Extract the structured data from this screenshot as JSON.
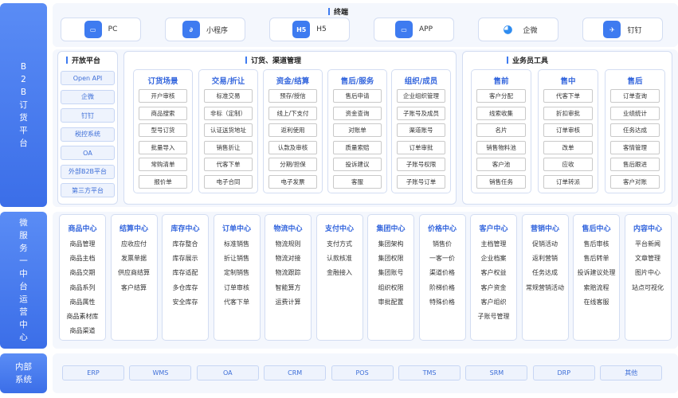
{
  "sides": {
    "b2b": "B2B订货平台",
    "mid": "微服务一中台运营中心",
    "internal": "内部系统"
  },
  "terminal": {
    "title": "终端",
    "items": [
      {
        "label": "PC",
        "icon": "monitor-icon"
      },
      {
        "label": "小程序",
        "icon": "mini-program-icon"
      },
      {
        "label": "H5",
        "icon": "h5-icon"
      },
      {
        "label": "APP",
        "icon": "monitor-icon"
      },
      {
        "label": "企微",
        "icon": "wecom-icon"
      },
      {
        "label": "钉钉",
        "icon": "dingtalk-icon"
      }
    ]
  },
  "open_platform": {
    "title": "开放平台",
    "items": [
      "Open API",
      "企微",
      "钉钉",
      "税控系统",
      "OA",
      "外部B2B平台",
      "第三方平台"
    ]
  },
  "ordering": {
    "title": "订货、渠道管理",
    "cols": [
      {
        "title": "订货场景",
        "items": [
          "开户审核",
          "商品搜索",
          "型号订货",
          "批量导入",
          "常购清单",
          "报价单"
        ]
      },
      {
        "title": "交易/折让",
        "items": [
          "标准交易",
          "非标（定制）",
          "认证送货地址",
          "销售折让",
          "代客下单",
          "电子合同"
        ]
      },
      {
        "title": "资金/结算",
        "items": [
          "预存/授信",
          "线上/下支付",
          "返利使用",
          "认款及审核",
          "分期/担保",
          "电子发票"
        ]
      },
      {
        "title": "售后/服务",
        "items": [
          "售后申请",
          "资金查询",
          "对账单",
          "质量索赔",
          "投诉建议",
          "客服"
        ]
      },
      {
        "title": "组织/成员",
        "items": [
          "企业组织管理",
          "子账号及成员",
          "渠道账号",
          "订单审批",
          "子账号权限",
          "子账号订单"
        ]
      }
    ]
  },
  "sales": {
    "title": "业务员工具",
    "cols": [
      {
        "title": "售前",
        "items": [
          "客户分配",
          "线索收集",
          "名片",
          "销售物料池",
          "客户池",
          "销售任务"
        ]
      },
      {
        "title": "售中",
        "items": [
          "代客下单",
          "折扣审批",
          "订单审核",
          "改单",
          "应收",
          "订单转派"
        ]
      },
      {
        "title": "售后",
        "items": [
          "订单查询",
          "业绩统计",
          "任务达成",
          "客情管理",
          "售后跟进",
          "客户对账"
        ]
      }
    ]
  },
  "centers": [
    {
      "title": "商品中心",
      "items": [
        "商品管理",
        "商品主档",
        "商品交期",
        "商品系列",
        "商品属性",
        "商品素材库",
        "商品渠道"
      ]
    },
    {
      "title": "结算中心",
      "items": [
        "应收应付",
        "发票单据",
        "供应商结算",
        "客户结算"
      ]
    },
    {
      "title": "库存中心",
      "items": [
        "库存整合",
        "库存展示",
        "库存适配",
        "多仓库存",
        "安全库存"
      ]
    },
    {
      "title": "订单中心",
      "items": [
        "标准销售",
        "折让销售",
        "定制销售",
        "订单审核",
        "代客下单"
      ]
    },
    {
      "title": "物流中心",
      "items": [
        "物流规则",
        "物流对接",
        "物流跟踪",
        "智能算方",
        "运费计算"
      ]
    },
    {
      "title": "支付中心",
      "items": [
        "支付方式",
        "认款核准",
        "金融接入"
      ]
    },
    {
      "title": "集团中心",
      "items": [
        "集团架构",
        "集团权限",
        "集团账号",
        "组织权限",
        "审批配置"
      ]
    },
    {
      "title": "价格中心",
      "items": [
        "销售价",
        "一客一价",
        "渠道价格",
        "阶梯价格",
        "特殊价格"
      ]
    },
    {
      "title": "客户中心",
      "items": [
        "主档管理",
        "企业档案",
        "客户权益",
        "客户资金",
        "客户组织",
        "子账号管理"
      ]
    },
    {
      "title": "营销中心",
      "items": [
        "促销活动",
        "返利营销",
        "任务达成",
        "常规营销活动"
      ]
    },
    {
      "title": "售后中心",
      "items": [
        "售后审核",
        "售后转单",
        "投诉建议处理",
        "索赔流程",
        "在线客服"
      ]
    },
    {
      "title": "内容中心",
      "items": [
        "平台新闻",
        "文章管理",
        "图片中心",
        "站点可视化"
      ]
    }
  ],
  "internal": [
    "ERP",
    "WMS",
    "OA",
    "CRM",
    "POS",
    "TMS",
    "SRM",
    "DRP",
    "其他"
  ]
}
